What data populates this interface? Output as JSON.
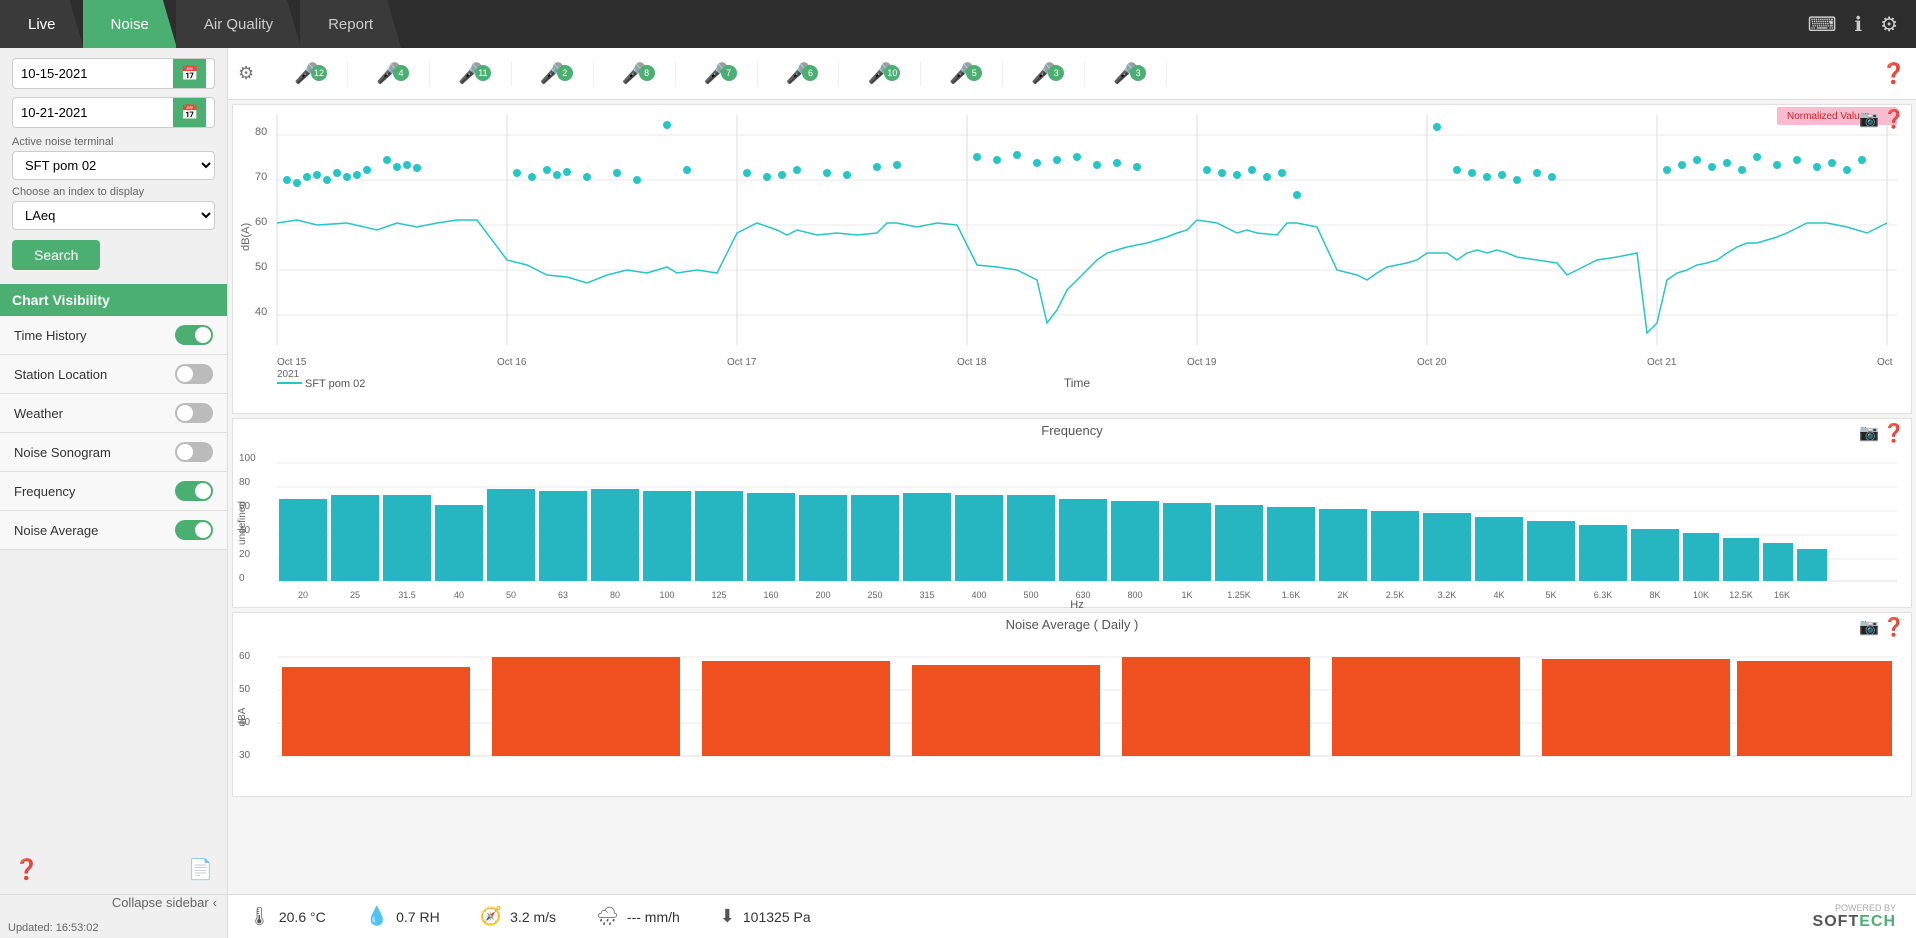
{
  "nav": {
    "tabs": [
      {
        "id": "live",
        "label": "Live",
        "active": false
      },
      {
        "id": "noise",
        "label": "Noise",
        "active": true
      },
      {
        "id": "airquality",
        "label": "Air Quality",
        "active": false
      },
      {
        "id": "report",
        "label": "Report",
        "active": false
      }
    ],
    "icons": {
      "keyboard": "⌨",
      "info": "ℹ",
      "settings": "⚙"
    }
  },
  "sidebar": {
    "date_start": "10-15-2021",
    "date_end": "10-21-2021",
    "active_terminal_label": "Active noise terminal",
    "active_terminal_value": "SFT pom 02",
    "index_label": "Choose an index to display",
    "index_value": "LAeq",
    "search_label": "Search",
    "chart_visibility_label": "Chart Visibility",
    "toggles": [
      {
        "id": "time-history",
        "label": "Time History",
        "on": true
      },
      {
        "id": "station-location",
        "label": "Station Location",
        "on": false
      },
      {
        "id": "weather",
        "label": "Weather",
        "on": false
      },
      {
        "id": "noise-sonogram",
        "label": "Noise Sonogram",
        "on": false
      },
      {
        "id": "frequency",
        "label": "Frequency",
        "on": true
      },
      {
        "id": "noise-average",
        "label": "Noise Average",
        "on": true
      }
    ],
    "collapse_label": "Collapse sidebar",
    "updated_label": "Updated: 16:53:02"
  },
  "stations": [
    {
      "id": "s1",
      "badge": "12"
    },
    {
      "id": "s2",
      "badge": "4"
    },
    {
      "id": "s3",
      "badge": "11"
    },
    {
      "id": "s4",
      "badge": "2"
    },
    {
      "id": "s5",
      "badge": "8"
    },
    {
      "id": "s6",
      "badge": "7"
    },
    {
      "id": "s7",
      "badge": "6"
    },
    {
      "id": "s8",
      "badge": "10"
    },
    {
      "id": "s9",
      "badge": "5"
    },
    {
      "id": "s10",
      "badge": "3"
    },
    {
      "id": "s11",
      "badge": "3"
    }
  ],
  "charts": {
    "time_history": {
      "title": "Time",
      "legend": "SFT pom 02",
      "normalized_label": "Normalized Values",
      "x_labels": [
        "Oct 15\n2021",
        "Oct 16",
        "Oct 17",
        "Oct 18",
        "Oct 19",
        "Oct 20",
        "Oct 21",
        "Oct"
      ],
      "y_labels": [
        "80",
        "70",
        "60",
        "50",
        "40"
      ],
      "y_axis_label": "dB(A)"
    },
    "frequency": {
      "title": "Frequency",
      "x_label": "Hz",
      "y_label": "undefined",
      "y_labels": [
        "100",
        "80",
        "60",
        "40",
        "20",
        "0"
      ],
      "x_labels": [
        "20",
        "25",
        "31.5",
        "40",
        "50",
        "63",
        "80",
        "100",
        "125",
        "160",
        "200",
        "250",
        "315",
        "400",
        "500",
        "630",
        "800",
        "1K",
        "1.25K",
        "1.6K",
        "2K",
        "2.5K",
        "3.2K",
        "4K",
        "5K",
        "6.3K",
        "8K",
        "10K",
        "12.5K",
        "16K"
      ]
    },
    "noise_average": {
      "title": "Noise Average ( Daily )",
      "y_label": "dBA",
      "y_labels": [
        "60",
        "50",
        "40",
        "30"
      ]
    }
  },
  "status_bar": {
    "temperature": "20.6 °C",
    "humidity": "0.7 RH",
    "wind": "3.2 m/s",
    "rain": "--- mm/h",
    "pressure": "101325 Pa",
    "updated": "Updated: 16:53:02"
  }
}
